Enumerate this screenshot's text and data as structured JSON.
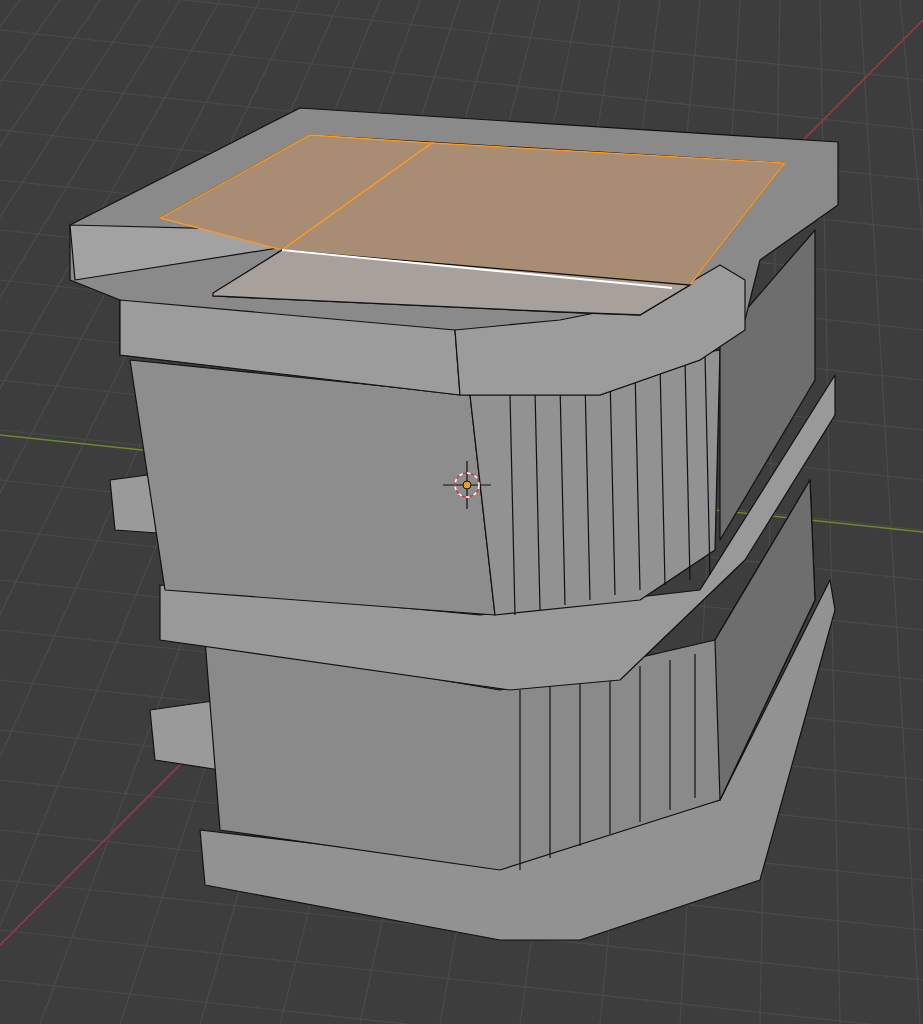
{
  "viewport": {
    "top_faces": [
      {
        "selected": true
      },
      {
        "selected": true
      },
      {
        "selected": false
      }
    ]
  }
}
